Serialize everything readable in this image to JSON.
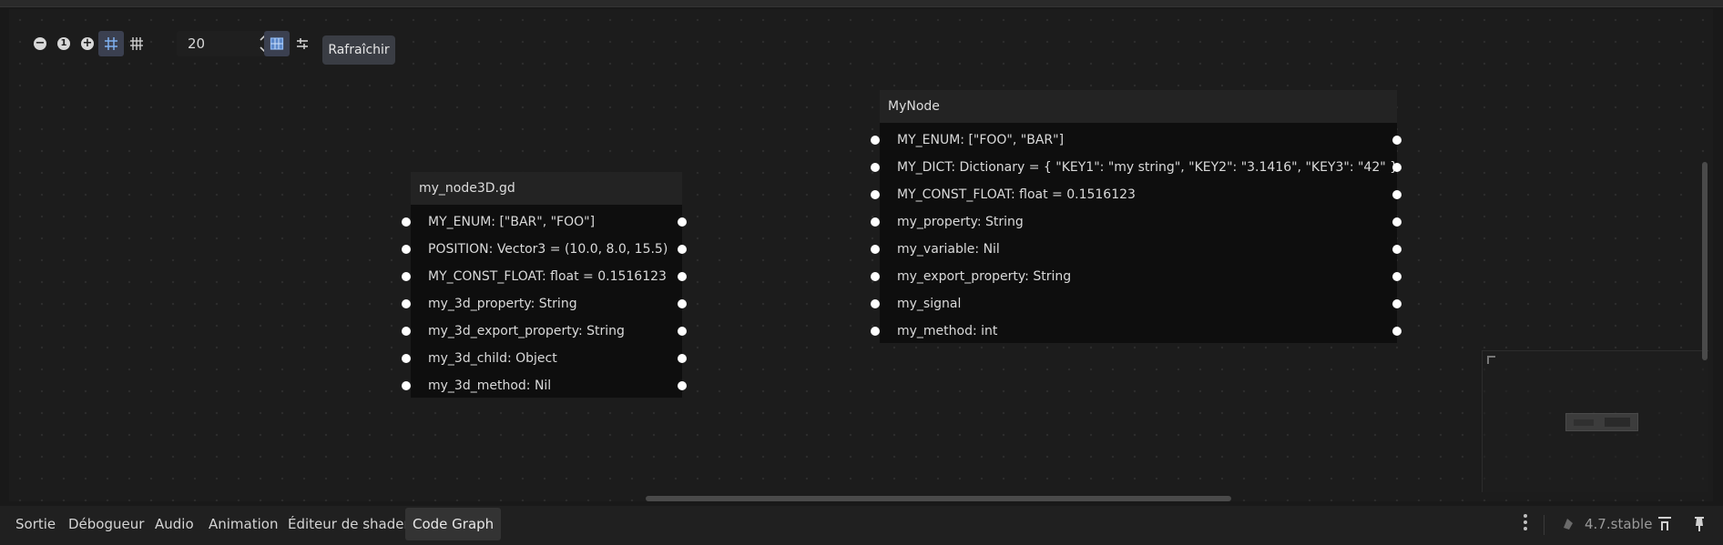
{
  "toolbar": {
    "zoom_out_icon": "minus-circle-icon",
    "zoom_reset_label": "1",
    "zoom_in_icon": "plus-circle-icon",
    "snap_value": "20",
    "refresh_label": "Rafraîchir"
  },
  "nodes": [
    {
      "title": "my_node3D.gd",
      "rows": [
        "MY_ENUM: [\"BAR\", \"FOO\"]",
        "POSITION: Vector3 = (10.0, 8.0, 15.5)",
        "MY_CONST_FLOAT: float = 0.1516123",
        "my_3d_property: String",
        "my_3d_export_property: String",
        "my_3d_child: Object",
        "my_3d_method: Nil"
      ]
    },
    {
      "title": "MyNode",
      "rows": [
        "MY_ENUM: [\"FOO\", \"BAR\"]",
        "MY_DICT: Dictionary = { \"KEY1\": \"my string\", \"KEY2\": \"3.1416\", \"KEY3\": \"42\" }",
        "MY_CONST_FLOAT: float = 0.1516123",
        "my_property: String",
        "my_variable: Nil",
        "my_export_property: String",
        "my_signal",
        "my_method: int"
      ]
    }
  ],
  "bottom": {
    "tabs": [
      "Sortie",
      "Débogueur",
      "Audio",
      "Animation",
      "Éditeur de shader",
      "Code Graph"
    ],
    "active_tab": "Code Graph",
    "version": "4.7.stable"
  },
  "colors": {
    "panel_bg": "#1c1c1c",
    "node_bg": "#0e0e0e",
    "node_title_bg": "#232323",
    "accent": "#6aa0e6"
  }
}
